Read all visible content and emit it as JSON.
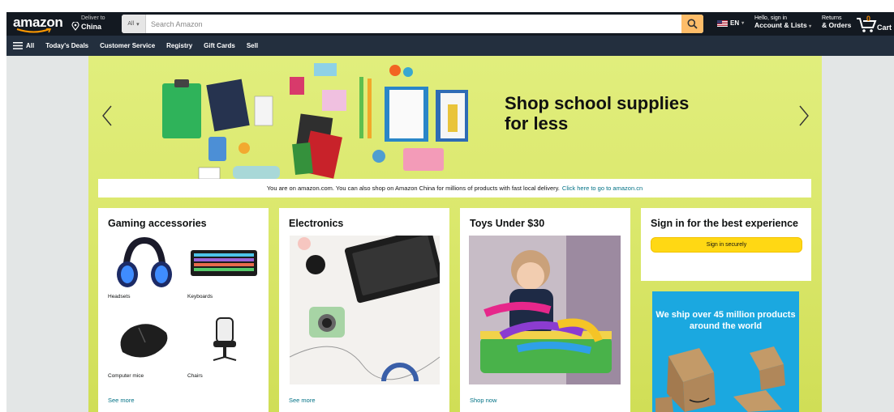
{
  "header": {
    "logo": "amazon",
    "deliver_line1": "Deliver to",
    "deliver_line2": "China",
    "search_category": "All",
    "search_placeholder": "Search Amazon",
    "language": "EN",
    "account_line1": "Hello, sign in",
    "account_line2": "Account & Lists",
    "returns_line1": "Returns",
    "returns_line2": "& Orders",
    "cart_count": "0",
    "cart_label": "Cart"
  },
  "subnav": {
    "all": "All",
    "items": [
      "Today's Deals",
      "Customer Service",
      "Registry",
      "Gift Cards",
      "Sell"
    ]
  },
  "hero": {
    "title": "Shop school supplies for less"
  },
  "notice": {
    "text": "You are on amazon.com. You can also shop on Amazon China for millions of products with fast local delivery.",
    "link": "Click here to go to amazon.cn"
  },
  "cards": {
    "gaming": {
      "title": "Gaming accessories",
      "items": [
        "Headsets",
        "Keyboards",
        "Computer mice",
        "Chairs"
      ],
      "link": "See more"
    },
    "electronics": {
      "title": "Electronics",
      "link": "See more"
    },
    "toys": {
      "title": "Toys Under $30",
      "link": "Shop now"
    },
    "signin": {
      "title": "Sign in for the best experience",
      "button": "Sign in securely"
    },
    "ship_ad": {
      "text": "We ship over 45 million products around the world"
    }
  },
  "colors": {
    "nav_dark": "#131921",
    "nav_secondary": "#232f3e",
    "search_button": "#febd69",
    "signin_button": "#ffd814",
    "link": "#007185",
    "hero_bg": "#dbe86d",
    "ship_ad_bg": "#1ba8e0"
  }
}
